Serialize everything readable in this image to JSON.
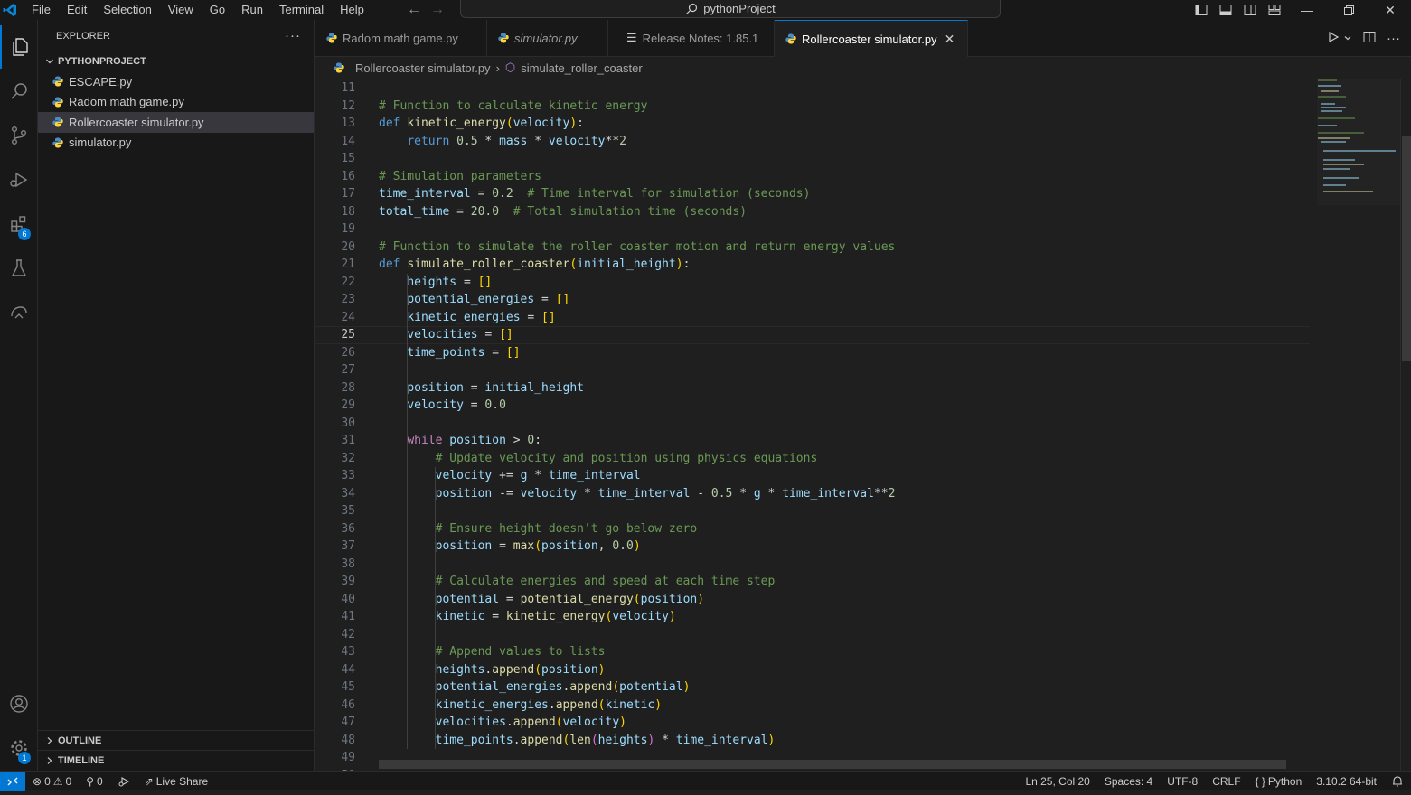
{
  "menu": [
    "File",
    "Edit",
    "Selection",
    "View",
    "Go",
    "Run",
    "Terminal",
    "Help"
  ],
  "command_center": {
    "label": "pythonProject"
  },
  "explorer": {
    "header": "EXPLORER",
    "project": "PYTHONPROJECT",
    "files": [
      "ESCAPE.py",
      "Radom math game.py",
      "Rollercoaster simulator.py",
      "simulator.py"
    ],
    "selected_index": 2,
    "outline": "OUTLINE",
    "timeline": "TIMELINE"
  },
  "activity": {
    "extensions_badge": "6",
    "settings_badge": "1"
  },
  "tabs": [
    {
      "label": "Radom math game.py",
      "italic": false
    },
    {
      "label": "simulator.py",
      "italic": true
    },
    {
      "label": "Release Notes: 1.85.1",
      "italic": false
    },
    {
      "label": "Rollercoaster simulator.py",
      "italic": false,
      "active": true
    }
  ],
  "breadcrumb": {
    "file": "Rollercoaster simulator.py",
    "symbol": "simulate_roller_coaster"
  },
  "editor": {
    "first_line": 11,
    "current_line": 25,
    "lines": [
      "",
      "# Function to calculate kinetic energy",
      "def kinetic_energy(velocity):",
      "    return 0.5 * mass * velocity**2",
      "",
      "# Simulation parameters",
      "time_interval = 0.2  # Time interval for simulation (seconds)",
      "total_time = 20.0  # Total simulation time (seconds)",
      "",
      "# Function to simulate the roller coaster motion and return energy values",
      "def simulate_roller_coaster(initial_height):",
      "    heights = []",
      "    potential_energies = []",
      "    kinetic_energies = []",
      "    velocities = []",
      "    time_points = []",
      "",
      "    position = initial_height",
      "    velocity = 0.0",
      "",
      "    while position > 0:",
      "        # Update velocity and position using physics equations",
      "        velocity += g * time_interval",
      "        position -= velocity * time_interval - 0.5 * g * time_interval**2",
      "",
      "        # Ensure height doesn't go below zero",
      "        position = max(position, 0.0)",
      "",
      "        # Calculate energies and speed at each time step",
      "        potential = potential_energy(position)",
      "        kinetic = kinetic_energy(velocity)",
      "",
      "        # Append values to lists",
      "        heights.append(position)",
      "        potential_energies.append(potential)",
      "        kinetic_energies.append(kinetic)",
      "        velocities.append(velocity)",
      "        time_points.append(len(heights) * time_interval)",
      "",
      ""
    ]
  },
  "status": {
    "errors": "0",
    "warnings": "0",
    "ports": "0",
    "live_share": "Live Share",
    "position": "Ln 25, Col 20",
    "spaces": "Spaces: 4",
    "encoding": "UTF-8",
    "eol": "CRLF",
    "language": "Python",
    "interpreter": "3.10.2 64-bit"
  },
  "colors": {
    "accent": "#0078d4",
    "background": "#1f1f1f",
    "chrome": "#181818"
  }
}
